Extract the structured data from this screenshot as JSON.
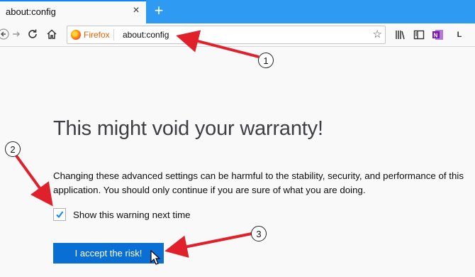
{
  "tab": {
    "title": "about:config",
    "close_glyph": "×",
    "new_tab_glyph": "+"
  },
  "toolbar": {
    "back_icon": "arrow-left-icon",
    "forward_icon": "arrow-right-icon",
    "reload_icon": "reload-icon",
    "home_icon": "home-icon",
    "library_icon": "library-icon",
    "sidebar_icon": "sidebar-icon",
    "onenote_icon": "onenote-icon",
    "extension_label": "L"
  },
  "urlbar": {
    "identity_label": "Firefox",
    "url": "about:config",
    "star_glyph": "☆"
  },
  "content": {
    "heading": "This might void your warranty!",
    "warning_text": "Changing these advanced settings can be harmful to the stability, security, and performance of this application. You should only continue if you are sure of what you are doing.",
    "checkbox_label": "Show this warning next time",
    "checkbox_checked": true,
    "accept_button": "I accept the risk!"
  },
  "annotations": {
    "badges": [
      "1",
      "2",
      "3"
    ],
    "arrow_color": "#e0202a"
  },
  "colors": {
    "tabstrip": "#2e9af2",
    "accent": "#0a84ff",
    "button": "#0a6fd5"
  }
}
